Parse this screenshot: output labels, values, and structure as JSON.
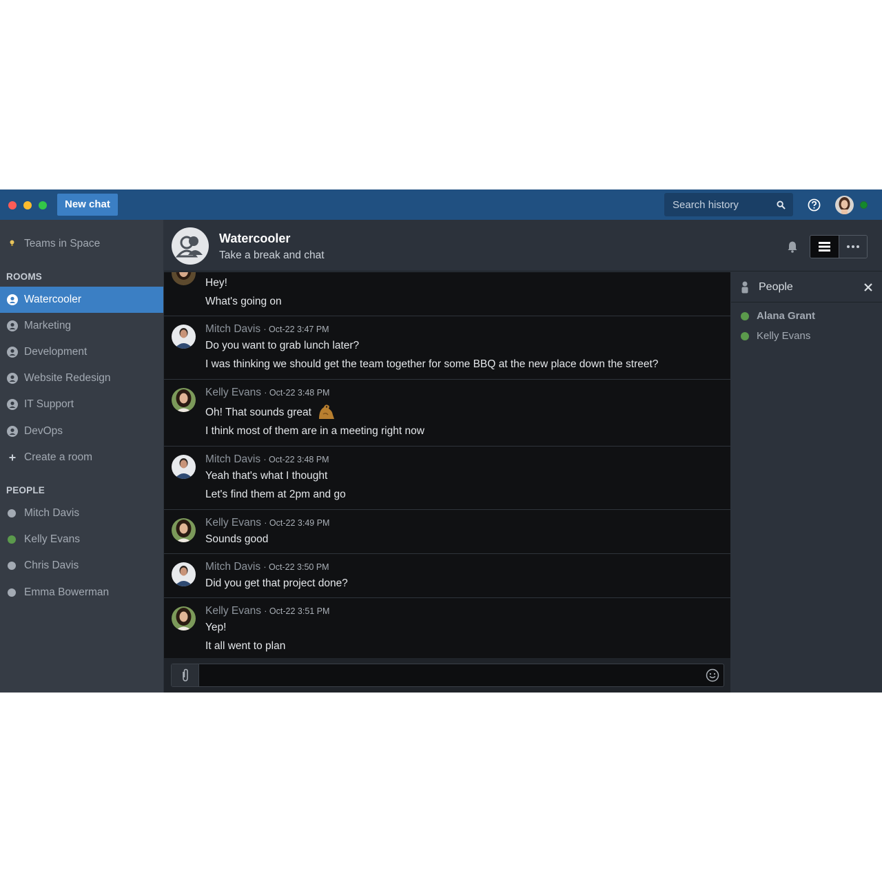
{
  "topbar": {
    "new_chat_label": "New chat",
    "search_placeholder": "Search history"
  },
  "sidebar": {
    "workspace": "Teams in Space",
    "rooms_header": "ROOMS",
    "rooms": [
      {
        "label": "Watercooler",
        "active": true
      },
      {
        "label": "Marketing"
      },
      {
        "label": "Development"
      },
      {
        "label": "Website Redesign"
      },
      {
        "label": "IT Support"
      },
      {
        "label": "DevOps"
      }
    ],
    "create_room_label": "Create a room",
    "people_header": "PEOPLE",
    "people": [
      {
        "label": "Mitch Davis",
        "status": "offline"
      },
      {
        "label": "Kelly Evans",
        "status": "online"
      },
      {
        "label": "Chris Davis",
        "status": "offline"
      },
      {
        "label": "Emma Bowerman",
        "status": "offline"
      }
    ]
  },
  "room": {
    "title": "Watercooler",
    "topic": "Take a break and chat"
  },
  "messages": [
    {
      "author": "",
      "time": "",
      "lines": [
        "Hey!",
        "What's going on"
      ]
    },
    {
      "author": "Mitch Davis",
      "time": "· Oct-22 3:47 PM",
      "lines": [
        "Do you want to grab lunch later?",
        "I was thinking we should get the team together for some BBQ at the new place down the street?"
      ]
    },
    {
      "author": "Kelly Evans",
      "time": "· Oct-22 3:48 PM",
      "lines": [
        "Oh! That sounds great",
        "I think most of them are in a meeting right now"
      ]
    },
    {
      "author": "Mitch Davis",
      "time": "· Oct-22 3:48 PM",
      "lines": [
        "Yeah that's what I thought",
        "Let's find them at 2pm and go"
      ]
    },
    {
      "author": "Kelly Evans",
      "time": "· Oct-22 3:49 PM",
      "lines": [
        "Sounds good"
      ]
    },
    {
      "author": "Mitch Davis",
      "time": "· Oct-22 3:50 PM",
      "lines": [
        "Did you get that project done?"
      ]
    },
    {
      "author": "Kelly Evans",
      "time": "· Oct-22 3:51 PM",
      "lines": [
        "Yep!",
        "It all went to plan"
      ]
    }
  ],
  "composer": {
    "value": ""
  },
  "people_panel": {
    "title": "People",
    "members": [
      {
        "label": "Alana Grant",
        "bold": true
      },
      {
        "label": "Kelly Evans",
        "bold": false
      }
    ]
  },
  "colors": {
    "topbar": "#205081",
    "accent": "#3b7fc4",
    "online": "#5b9a4c",
    "sidebar": "#363c45",
    "chat_bg": "#101113"
  },
  "icons": [
    "search-icon",
    "help-icon",
    "bell-icon",
    "list-icon",
    "more-icon",
    "close-icon",
    "attach-icon",
    "emoji-icon",
    "room-icon",
    "person-icon",
    "lightbulb-icon"
  ]
}
